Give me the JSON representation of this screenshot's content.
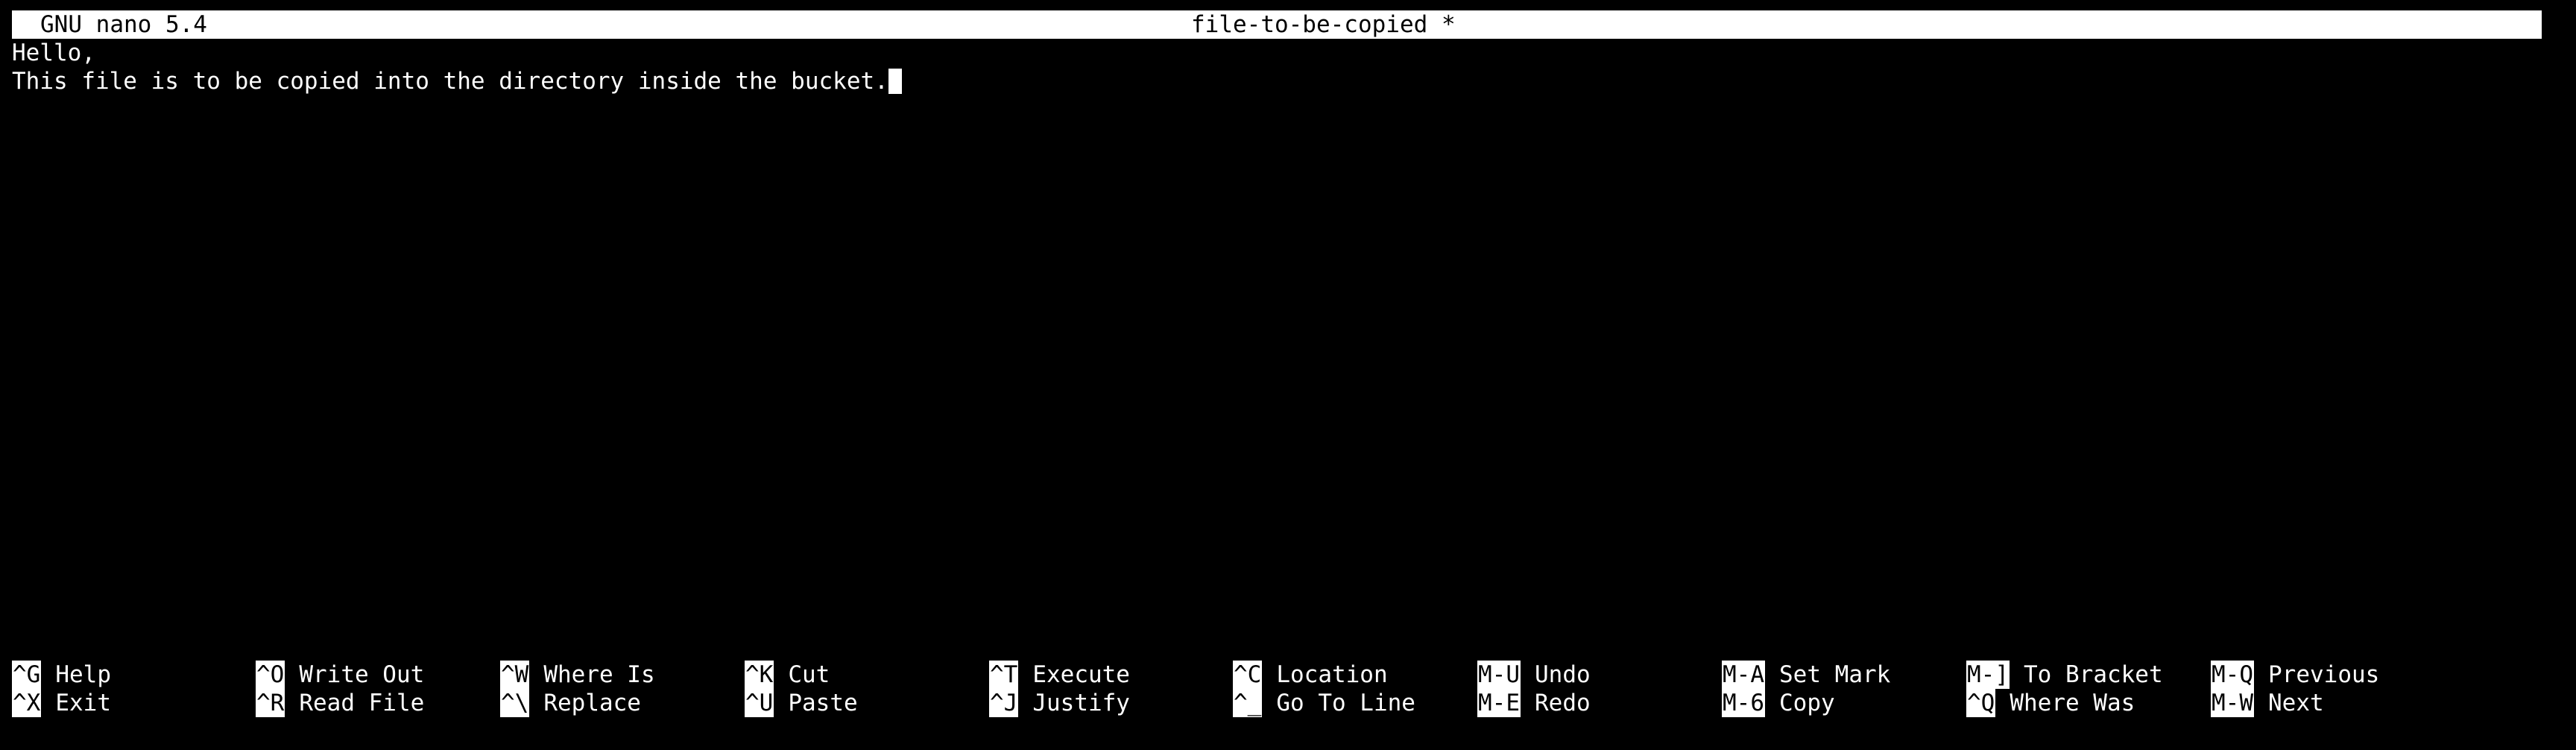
{
  "titlebar": {
    "app_version": "GNU nano 5.4",
    "filename": "file-to-be-copied *"
  },
  "editor": {
    "lines": [
      "Hello,",
      "This file is to be copied into the directory inside the bucket."
    ]
  },
  "shortcuts": [
    {
      "key": "^G",
      "label": "Help"
    },
    {
      "key": "^X",
      "label": "Exit"
    },
    {
      "key": "^O",
      "label": "Write Out"
    },
    {
      "key": "^R",
      "label": "Read File"
    },
    {
      "key": "^W",
      "label": "Where Is"
    },
    {
      "key": "^\\",
      "label": "Replace"
    },
    {
      "key": "^K",
      "label": "Cut"
    },
    {
      "key": "^U",
      "label": "Paste"
    },
    {
      "key": "^T",
      "label": "Execute"
    },
    {
      "key": "^J",
      "label": "Justify"
    },
    {
      "key": "^C",
      "label": "Location"
    },
    {
      "key": "^_",
      "label": "Go To Line"
    },
    {
      "key": "M-U",
      "label": "Undo"
    },
    {
      "key": "M-E",
      "label": "Redo"
    },
    {
      "key": "M-A",
      "label": "Set Mark"
    },
    {
      "key": "M-6",
      "label": "Copy"
    },
    {
      "key": "M-]",
      "label": "To Bracket"
    },
    {
      "key": "^Q",
      "label": "Where Was"
    },
    {
      "key": "M-Q",
      "label": "Previous"
    },
    {
      "key": "M-W",
      "label": "Next"
    }
  ]
}
